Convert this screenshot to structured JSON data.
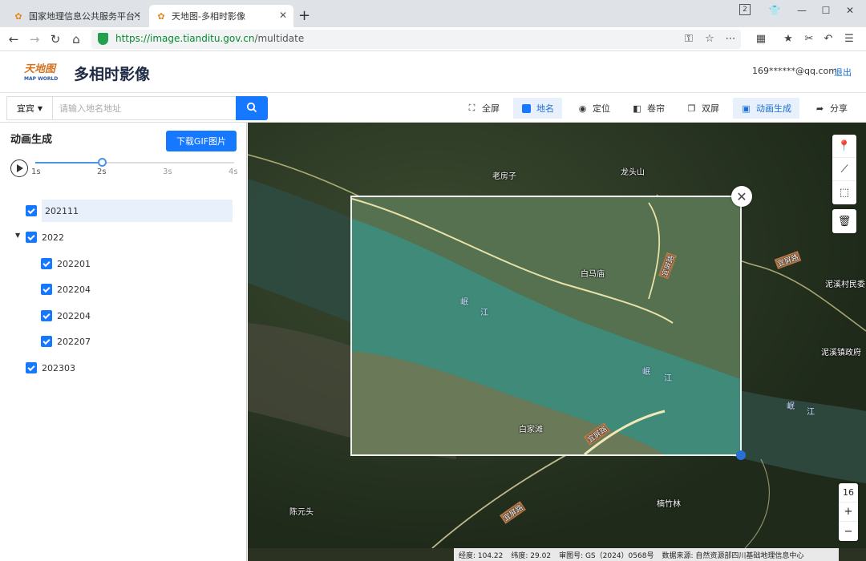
{
  "browser": {
    "tabs": [
      {
        "title": "国家地理信息公共服务平台 天"
      },
      {
        "title": "天地图-多相时影像"
      }
    ],
    "url_host": "https://image.tianditu.gov.cn",
    "url_path": "/multidate",
    "tab_count_badge": "2"
  },
  "app": {
    "logo_text": "天地图",
    "logo_sub": "MAP WORLD",
    "title": "多相时影像",
    "user_email": "169******@qq.com",
    "logout_label": "退出"
  },
  "search": {
    "city": "宜宾",
    "placeholder": "请输入地名地址"
  },
  "toolbar": {
    "items": [
      {
        "label": "全屏",
        "icon": "fullscreen-icon"
      },
      {
        "label": "地名",
        "icon": "checkbox-icon"
      },
      {
        "label": "定位",
        "icon": "locate-icon"
      },
      {
        "label": "卷帘",
        "icon": "swipe-icon"
      },
      {
        "label": "双屏",
        "icon": "dual-screen-icon"
      },
      {
        "label": "动画生成",
        "icon": "animation-icon"
      },
      {
        "label": "分享",
        "icon": "share-icon"
      }
    ]
  },
  "panel": {
    "title": "动画生成",
    "gif_button": "下载GIF图片",
    "slider": {
      "ticks": [
        "1s",
        "2s",
        "3s",
        "4s"
      ],
      "value_s": 2,
      "min_s": 1,
      "max_s": 4
    },
    "tree": [
      {
        "label": "202111",
        "checked": true,
        "selected": true
      },
      {
        "label": "2022",
        "checked": true,
        "expanded": true,
        "children": [
          {
            "label": "202201",
            "checked": true
          },
          {
            "label": "202204",
            "checked": true
          },
          {
            "label": "202204",
            "checked": true
          },
          {
            "label": "202207",
            "checked": true
          }
        ]
      },
      {
        "label": "202303",
        "checked": true
      }
    ]
  },
  "map": {
    "place_labels": [
      "老房子",
      "龙头山",
      "白马庙",
      "泥溪村民委",
      "泥溪镇政府",
      "白家滩",
      "陈元头",
      "楠竹林"
    ],
    "river_labels": [
      "岷",
      "江",
      "岷",
      "江",
      "岷",
      "江"
    ],
    "road_labels": [
      "宜屏路",
      "宜屏路",
      "宜屏路",
      "宜屏路"
    ],
    "zoom_level": "16",
    "tools": [
      "marker-icon",
      "polyline-icon",
      "polygon-icon",
      "trash-icon"
    ]
  },
  "status": {
    "longitude": "经度: 104.22",
    "latitude": "纬度: 29.02",
    "approval": "审图号: GS（2024）0568号",
    "source": "数据来源: 自然资源部四川基础地理信息中心"
  }
}
